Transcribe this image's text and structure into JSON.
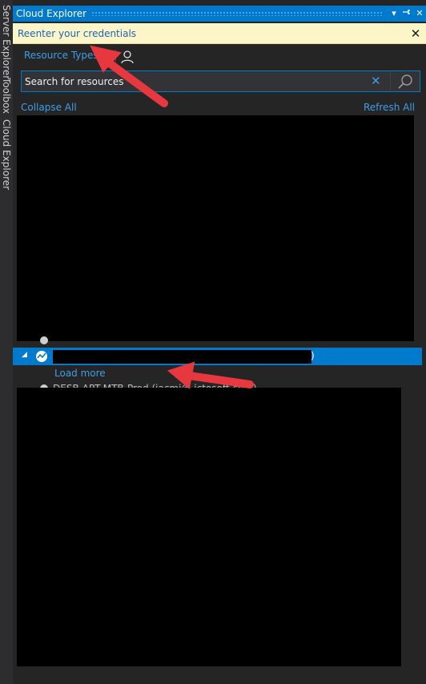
{
  "sidebar": {
    "tabs": [
      {
        "label": "Server Explorer"
      },
      {
        "label": "Toolbox"
      },
      {
        "label": "Cloud Explorer"
      }
    ]
  },
  "window": {
    "title": "Cloud Explorer",
    "dropdown_glyph": "▾",
    "pin_glyph": "⊣",
    "close_glyph": "✕"
  },
  "infobar": {
    "message": "Reenter your credentials",
    "close_glyph": "✕"
  },
  "tabs": {
    "resource_types": "Resource Types",
    "account_icon": "person-icon"
  },
  "search": {
    "placeholder": "Search for resources",
    "clear_glyph": "✕",
    "button_icon": "search-icon"
  },
  "actions": {
    "collapse_all": "Collapse All",
    "refresh_all": "Refresh All"
  },
  "tree": {
    "selected_item": {
      "expander": "◢",
      "icon": "subscription-icon",
      "trailing_text": ")"
    },
    "load_more": "Load more",
    "partial_text": "DESB-APT-MTB-Prod (jacmi@   ictosoft.com)"
  },
  "colors": {
    "accent": "#007acc",
    "link": "#3e9ee9",
    "infobar_bg": "#fcf5c7",
    "annotation_arrow": "#e8383f"
  }
}
